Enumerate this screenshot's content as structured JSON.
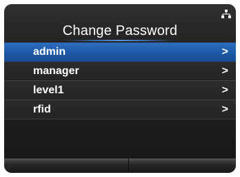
{
  "header": {
    "title": "Change Password",
    "status_icon": "network-icon"
  },
  "menu": {
    "items": [
      {
        "label": "admin",
        "arrow": ">",
        "selected": true
      },
      {
        "label": "manager",
        "arrow": ">",
        "selected": false
      },
      {
        "label": "level1",
        "arrow": ">",
        "selected": false
      },
      {
        "label": "rfid",
        "arrow": ">",
        "selected": false
      }
    ]
  },
  "colors": {
    "selection": "#1d5aa8",
    "background": "#1e1e1e",
    "text": "#ffffff"
  }
}
